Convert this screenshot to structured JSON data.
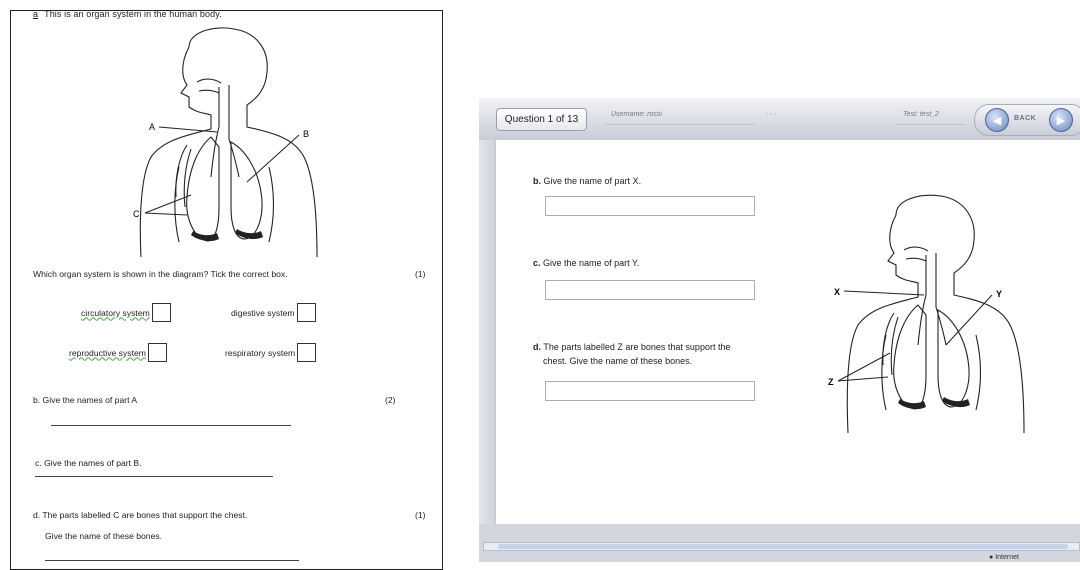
{
  "worksheet": {
    "intro_index": "a",
    "intro_text": "This is an organ system in the human body.",
    "diagram_labels": [
      "A",
      "B",
      "C"
    ],
    "question_a": "Which organ system is shown in the diagram?  Tick the correct box.",
    "question_a_mark": "(1)",
    "options": [
      {
        "label": "circulatory system"
      },
      {
        "label": "digestive system"
      },
      {
        "label": "reproductive system"
      },
      {
        "label": "respiratory system"
      }
    ],
    "question_b": "b. Give the names of part A",
    "question_b_mark": "(2)",
    "question_c": "c. Give the names of part B.",
    "question_d": "d. The parts labelled C are bones that support the chest.",
    "question_d_mark": "(1)",
    "question_d2": "Give the name of these bones."
  },
  "quiz": {
    "question_counter": "Question 1 of 13",
    "username": "Username: rossi",
    "dots": "· · ·",
    "test": "Test: test_2",
    "back_label": "BACK",
    "questions": [
      {
        "index": "b.",
        "text": "Give the name of part X."
      },
      {
        "index": "c.",
        "text": "Give the name of part Y."
      },
      {
        "index": "d.",
        "text": "The parts labelled Z are bones that support the",
        "line2": "chest.  Give the name of these bones."
      }
    ],
    "diagram_labels": [
      "X",
      "Y",
      "Z"
    ],
    "status": "Internet"
  },
  "icons": {
    "back": "arrow-left-icon",
    "next": "arrow-right-icon",
    "globe": "globe-icon"
  }
}
